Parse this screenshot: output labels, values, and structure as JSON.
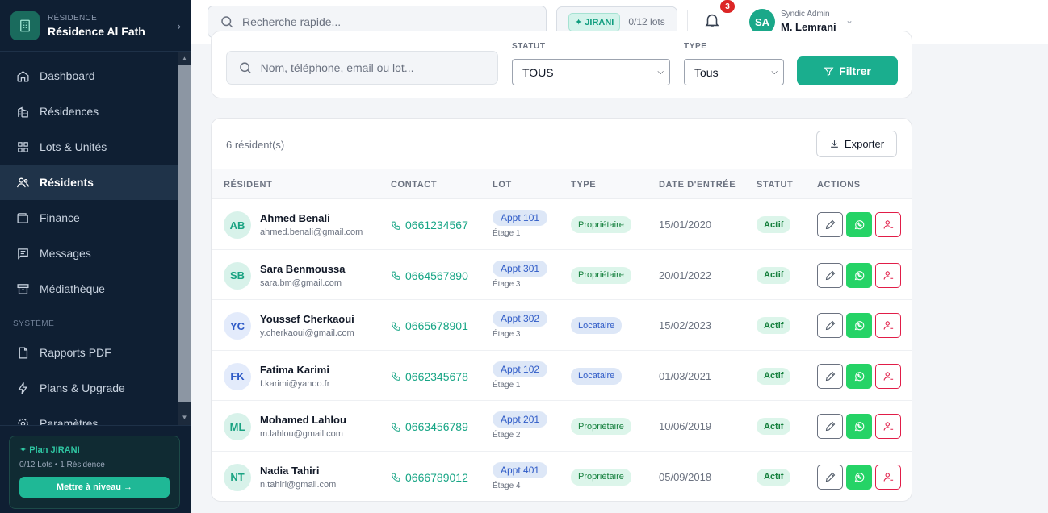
{
  "sidebar": {
    "residence_label": "RÉSIDENCE",
    "residence_name": "Résidence Al Fath",
    "nav": [
      {
        "label": "Dashboard",
        "icon": "home-icon"
      },
      {
        "label": "Résidences",
        "icon": "building-icon"
      },
      {
        "label": "Lots & Unités",
        "icon": "grid-icon"
      },
      {
        "label": "Résidents",
        "icon": "users-icon",
        "active": true
      },
      {
        "label": "Finance",
        "icon": "wallet-icon"
      },
      {
        "label": "Messages",
        "icon": "message-icon"
      },
      {
        "label": "Médiathèque",
        "icon": "archive-icon"
      }
    ],
    "section_system": "SYSTÈME",
    "system_nav": [
      {
        "label": "Rapports PDF",
        "icon": "file-icon"
      },
      {
        "label": "Plans & Upgrade",
        "icon": "bolt-icon"
      },
      {
        "label": "Paramètres",
        "icon": "gear-icon"
      }
    ],
    "plan": {
      "title": "✦ Plan JIRANI",
      "subtitle": "0/12 Lots • 1 Résidence",
      "button": "Mettre à niveau →"
    }
  },
  "topbar": {
    "search_placeholder": "Recherche rapide...",
    "plan_badge": "✦ JIRANI",
    "lots_count": "0/12 lots",
    "notifications_count": "3",
    "user_initials": "SA",
    "user_role": "Syndic Admin",
    "user_name": "M. Lemrani"
  },
  "filters": {
    "search_placeholder": "Nom, téléphone, email ou lot...",
    "statut_label": "STATUT",
    "statut_value": "TOUS",
    "type_label": "TYPE",
    "type_value": "Tous",
    "filter_button": "Filtrer"
  },
  "table": {
    "count_label": "6 résident(s)",
    "export_button": "Exporter",
    "headers": [
      "RÉSIDENT",
      "CONTACT",
      "LOT",
      "TYPE",
      "DATE D'ENTRÉE",
      "STATUT",
      "ACTIONS"
    ],
    "rows": [
      {
        "initials": "AB",
        "name": "Ahmed Benali",
        "email": "ahmed.benali@gmail.com",
        "phone": "0661234567",
        "lot": "Appt 101",
        "etage": "Étage 1",
        "type": "Propriétaire",
        "date": "15/01/2020",
        "statut": "Actif"
      },
      {
        "initials": "SB",
        "name": "Sara Benmoussa",
        "email": "sara.bm@gmail.com",
        "phone": "0664567890",
        "lot": "Appt 301",
        "etage": "Étage 3",
        "type": "Propriétaire",
        "date": "20/01/2022",
        "statut": "Actif"
      },
      {
        "initials": "YC",
        "name": "Youssef Cherkaoui",
        "email": "y.cherkaoui@gmail.com",
        "phone": "0665678901",
        "lot": "Appt 302",
        "etage": "Étage 3",
        "type": "Locataire",
        "date": "15/02/2023",
        "statut": "Actif"
      },
      {
        "initials": "FK",
        "name": "Fatima Karimi",
        "email": "f.karimi@yahoo.fr",
        "phone": "0662345678",
        "lot": "Appt 102",
        "etage": "Étage 1",
        "type": "Locataire",
        "date": "01/03/2021",
        "statut": "Actif"
      },
      {
        "initials": "ML",
        "name": "Mohamed Lahlou",
        "email": "m.lahlou@gmail.com",
        "phone": "0663456789",
        "lot": "Appt 201",
        "etage": "Étage 2",
        "type": "Propriétaire",
        "date": "10/06/2019",
        "statut": "Actif"
      },
      {
        "initials": "NT",
        "name": "Nadia Tahiri",
        "email": "n.tahiri@gmail.com",
        "phone": "0666789012",
        "lot": "Appt 401",
        "etage": "Étage 4",
        "type": "Propriétaire",
        "date": "05/09/2018",
        "statut": "Actif"
      }
    ]
  },
  "colors": {
    "sidebar_bg": "#0f1f33",
    "accent": "#1aae8e",
    "whatsapp": "#25d366",
    "danger": "#e11d48"
  }
}
